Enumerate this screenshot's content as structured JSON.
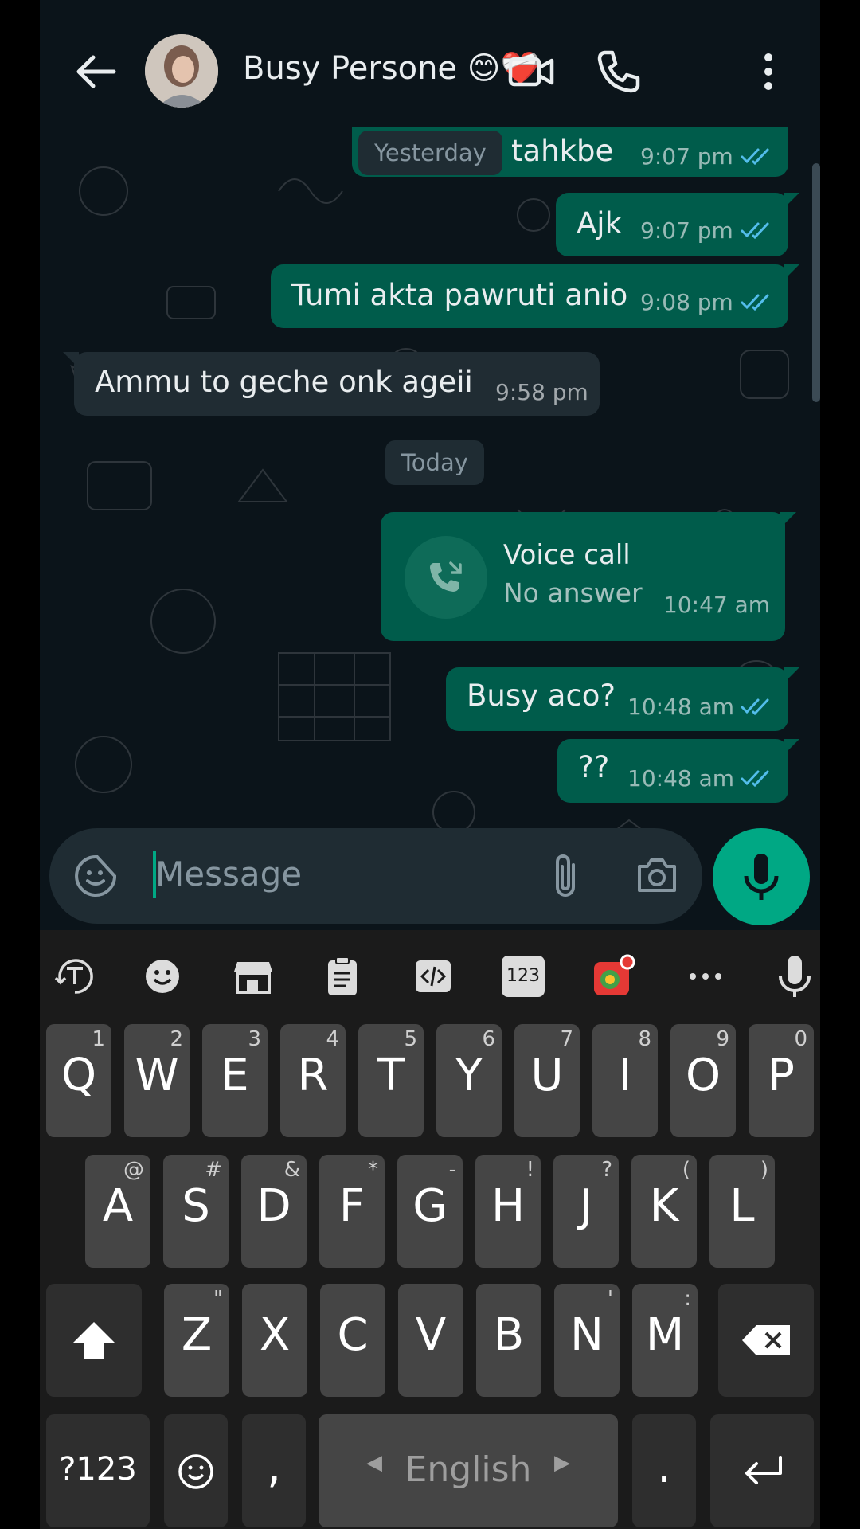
{
  "header": {
    "contact_name": "Busy Persone 😊❤️‍🩹"
  },
  "messages": [
    {
      "text": "tahkbe",
      "time": "9:07 pm",
      "direction": "outgoing"
    },
    {
      "text": "Ajk",
      "time": "9:07 pm",
      "direction": "outgoing"
    },
    {
      "text": "Tumi akta pawruti anio",
      "time": "9:08 pm",
      "direction": "outgoing"
    },
    {
      "text": "Ammu to geche onk ageii",
      "time": "9:58 pm",
      "direction": "incoming"
    },
    {
      "call_title": "Voice call",
      "call_status": "No answer",
      "time": "10:47 am",
      "direction": "outgoing"
    },
    {
      "text": "Busy aco?",
      "time": "10:48 am",
      "direction": "outgoing"
    },
    {
      "text": "??",
      "time": "10:48 am",
      "direction": "outgoing"
    }
  ],
  "date_chips": {
    "yesterday": "Yesterday",
    "today": "Today"
  },
  "composer": {
    "placeholder": "Message"
  },
  "keyboard": {
    "row1": [
      {
        "key": "Q",
        "hint": "1"
      },
      {
        "key": "W",
        "hint": "2"
      },
      {
        "key": "E",
        "hint": "3"
      },
      {
        "key": "R",
        "hint": "4"
      },
      {
        "key": "T",
        "hint": "5"
      },
      {
        "key": "Y",
        "hint": "6"
      },
      {
        "key": "U",
        "hint": "7"
      },
      {
        "key": "I",
        "hint": "8"
      },
      {
        "key": "O",
        "hint": "9"
      },
      {
        "key": "P",
        "hint": "0"
      }
    ],
    "row2": [
      {
        "key": "A",
        "hint": "@"
      },
      {
        "key": "S",
        "hint": "#"
      },
      {
        "key": "D",
        "hint": "&"
      },
      {
        "key": "F",
        "hint": "*"
      },
      {
        "key": "G",
        "hint": "-"
      },
      {
        "key": "H",
        "hint": "!"
      },
      {
        "key": "J",
        "hint": "?"
      },
      {
        "key": "K",
        "hint": "("
      },
      {
        "key": "L",
        "hint": ")"
      }
    ],
    "row3": [
      {
        "key": "Z",
        "hint": "\""
      },
      {
        "key": "X",
        "hint": ""
      },
      {
        "key": "C",
        "hint": ""
      },
      {
        "key": "V",
        "hint": ""
      },
      {
        "key": "B",
        "hint": ""
      },
      {
        "key": "N",
        "hint": "'"
      },
      {
        "key": "M",
        "hint": ":"
      }
    ],
    "symbols_label": "?123",
    "comma_label": ",",
    "space_label": "English",
    "period_label": ".",
    "toolbar_numbers_label": "123"
  },
  "colors": {
    "outgoing_bubble": "#005c4b",
    "incoming_bubble": "#202c33",
    "accent_green": "#00a884",
    "read_ticks": "#53bdeb"
  },
  "icons": [
    "back-arrow-icon",
    "video-call-icon",
    "phone-icon",
    "more-vert-icon",
    "sticker-icon",
    "attach-icon",
    "camera-icon",
    "mic-icon",
    "call-missed-icon",
    "text-format-icon",
    "emoji-icon",
    "store-icon",
    "clipboard-icon",
    "code-icon",
    "numbers-icon",
    "colors-icon",
    "more-horiz-icon",
    "voice-input-icon",
    "shift-icon",
    "backspace-icon",
    "enter-icon"
  ]
}
